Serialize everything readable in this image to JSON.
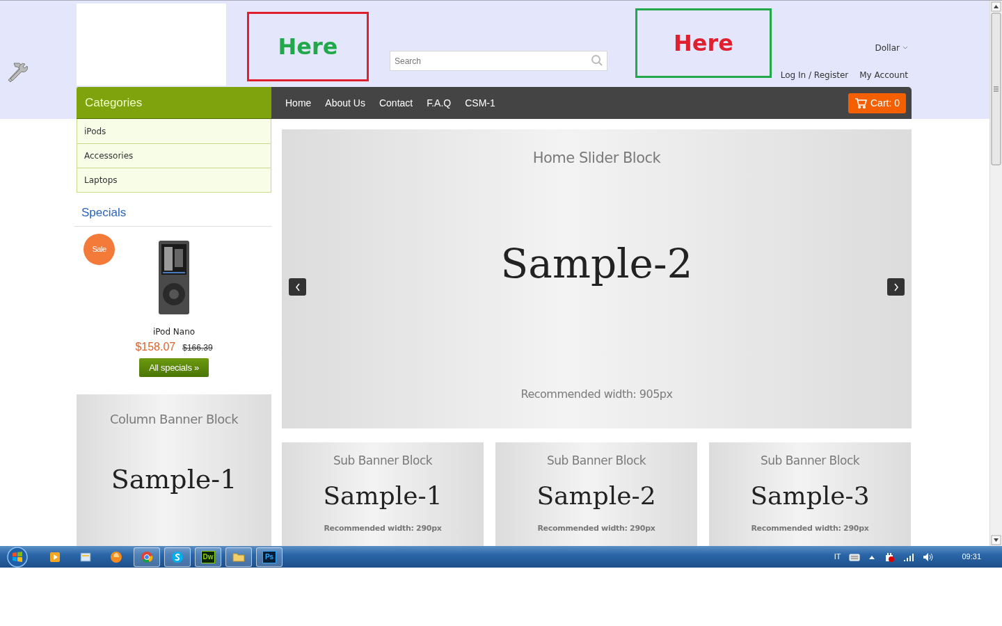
{
  "header": {
    "placeholders": [
      {
        "text": "Here",
        "color": "#21a84a",
        "frame": {
          "color": "#e0202e"
        }
      },
      {
        "text": "Here",
        "color": "#e0202e",
        "frame": {
          "color": "#21a84a"
        }
      }
    ],
    "search": {
      "placeholder": "Search"
    },
    "currency": "Dollar",
    "account_links": [
      "Log In / Register",
      "My Account"
    ]
  },
  "categories": {
    "title": "Categories",
    "items": [
      "iPods",
      "Accessories",
      "Laptops"
    ]
  },
  "nav": {
    "items": [
      "Home",
      "About Us",
      "Contact",
      "F.A.Q",
      "CSM-1"
    ],
    "cart": "Cart: 0"
  },
  "specials": {
    "title": "Specials",
    "product": {
      "badge": "Sale",
      "name": "iPod Nano",
      "price": "$158.07",
      "old_price": "$166.39"
    },
    "button": "All specials »"
  },
  "column_banner": {
    "title": "Column Banner Block",
    "text": "Sample-1"
  },
  "slider": {
    "title": "Home Slider Block",
    "text": "Sample-2",
    "note": "Recommended width: 905px"
  },
  "sub_banners": [
    {
      "title": "Sub Banner Block",
      "text": "Sample-1",
      "note": "Recommended width: 290px"
    },
    {
      "title": "Sub Banner Block",
      "text": "Sample-2",
      "note": "Recommended width: 290px"
    },
    {
      "title": "Sub Banner Block",
      "text": "Sample-3",
      "note": "Recommended width: 290px"
    }
  ],
  "taskbar": {
    "apps": [
      {
        "kind": "media",
        "open": false
      },
      {
        "kind": "explorer",
        "open": false
      },
      {
        "kind": "globe",
        "open": false
      },
      {
        "kind": "chrome",
        "open": true
      },
      {
        "kind": "skype",
        "open": true
      },
      {
        "kind": "dw",
        "label": "Dw",
        "open": true
      },
      {
        "kind": "folder",
        "open": true
      },
      {
        "kind": "ps",
        "label": "Ps",
        "open": true
      }
    ],
    "language": "IT",
    "time": "09:31"
  }
}
